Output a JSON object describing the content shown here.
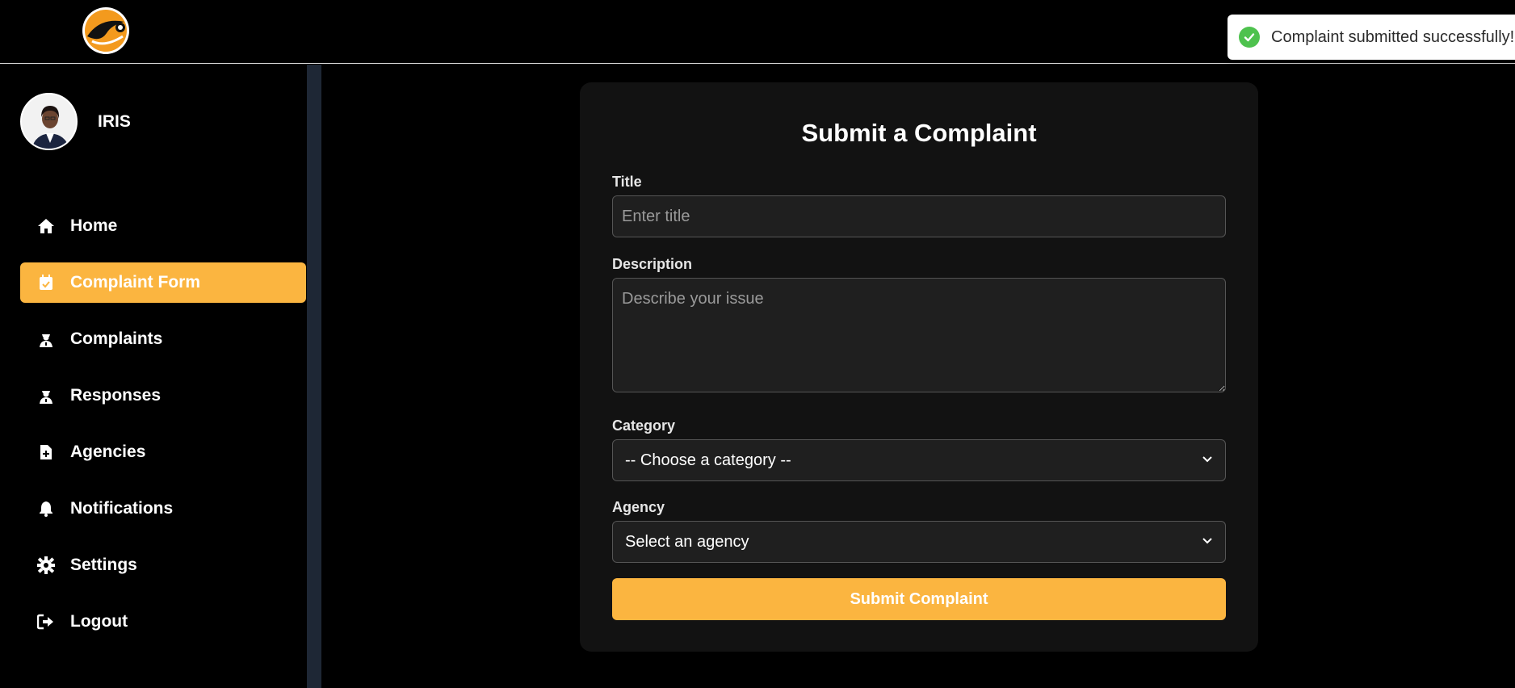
{
  "header": {
    "logo_name": "app-logo"
  },
  "toast": {
    "message": "Complaint submitted successfully!",
    "icon": "check-circle-icon",
    "color": "#4ec24e"
  },
  "sidebar": {
    "user": {
      "name": "IRIS"
    },
    "items": [
      {
        "label": "Home",
        "icon": "home-icon",
        "active": false
      },
      {
        "label": "Complaint Form",
        "icon": "calendar-check-icon",
        "active": true
      },
      {
        "label": "Complaints",
        "icon": "user-badge-icon",
        "active": false
      },
      {
        "label": "Responses",
        "icon": "user-badge-icon",
        "active": false
      },
      {
        "label": "Agencies",
        "icon": "file-plus-icon",
        "active": false
      },
      {
        "label": "Notifications",
        "icon": "bell-icon",
        "active": false
      },
      {
        "label": "Settings",
        "icon": "gear-icon",
        "active": false
      },
      {
        "label": "Logout",
        "icon": "logout-icon",
        "active": false
      }
    ],
    "accent_color": "#fbb540"
  },
  "form": {
    "title": "Submit a Complaint",
    "title_field": {
      "label": "Title",
      "value": "",
      "placeholder": "Enter title"
    },
    "description_field": {
      "label": "Description",
      "value": "",
      "placeholder": "Describe your issue"
    },
    "category_field": {
      "label": "Category",
      "selected": "-- Choose a category --"
    },
    "agency_field": {
      "label": "Agency",
      "selected": "Select an agency"
    },
    "submit_label": "Submit Complaint"
  }
}
